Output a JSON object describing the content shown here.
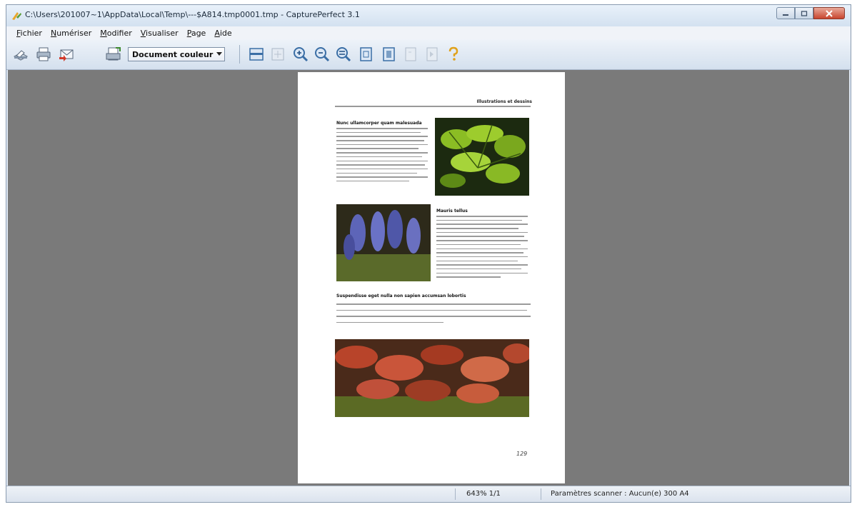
{
  "window": {
    "title": "C:\\Users\\201007~1\\AppData\\Local\\Temp\\---$A814.tmp0001.tmp - CapturePerfect 3.1"
  },
  "menu": {
    "items": [
      {
        "first": "F",
        "rest": "ichier"
      },
      {
        "first": "N",
        "rest": "umériser"
      },
      {
        "first": "M",
        "rest": "odifier"
      },
      {
        "first": "V",
        "rest": "isualiser"
      },
      {
        "first": "P",
        "rest": "age"
      },
      {
        "first": "A",
        "rest": "ide"
      }
    ]
  },
  "toolbar": {
    "mode_select": "Document couleur",
    "icons": [
      "scan-icon",
      "print-icon",
      "email-icon",
      "scan-settings-icon",
      "fit-page-icon",
      "fit-width-icon",
      "zoom-in-icon",
      "zoom-out-icon",
      "zoom-fit-icon",
      "rotate-left-icon",
      "rotate-right-icon",
      "prev-page-icon",
      "next-page-icon",
      "help-icon"
    ]
  },
  "document": {
    "header": "Illustrations et dessins",
    "heading1": "Nunc ullamcorper quam malesuada",
    "heading2": "Mauris tellus",
    "heading3": "Suspendisse eget nulla non sapien accumsan lobortis",
    "page_number": "129"
  },
  "status": {
    "zoom": "643% 1/1",
    "scanner": "Paramètres scanner :  Aucun(e)  300  A4"
  },
  "colors": {
    "viewport_bg": "#7a7a7a",
    "accent": "#3a6ea5"
  }
}
